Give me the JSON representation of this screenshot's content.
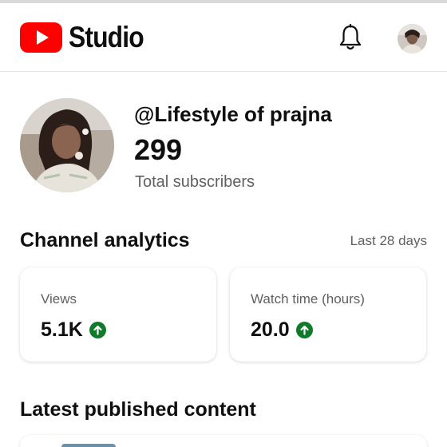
{
  "app": {
    "wordmark": "Studio",
    "brand_red": "#ff0000",
    "icons": {
      "logo": "youtube-play-icon",
      "notifications": "bell-icon",
      "account": "avatar"
    }
  },
  "channel": {
    "handle": "@Lifestyle of prajna",
    "subscribers": "299",
    "subscribers_label": "Total subscribers"
  },
  "analytics": {
    "title": "Channel analytics",
    "range": "Last 28 days",
    "cards": [
      {
        "label": "Views",
        "value": "5.1K",
        "trend": "up",
        "trend_color": "#0f7a2a"
      },
      {
        "label": "Watch time (hours)",
        "value": "20.0",
        "trend": "up",
        "trend_color": "#0f7a2a"
      }
    ]
  },
  "latest": {
    "title": "Latest published content"
  }
}
